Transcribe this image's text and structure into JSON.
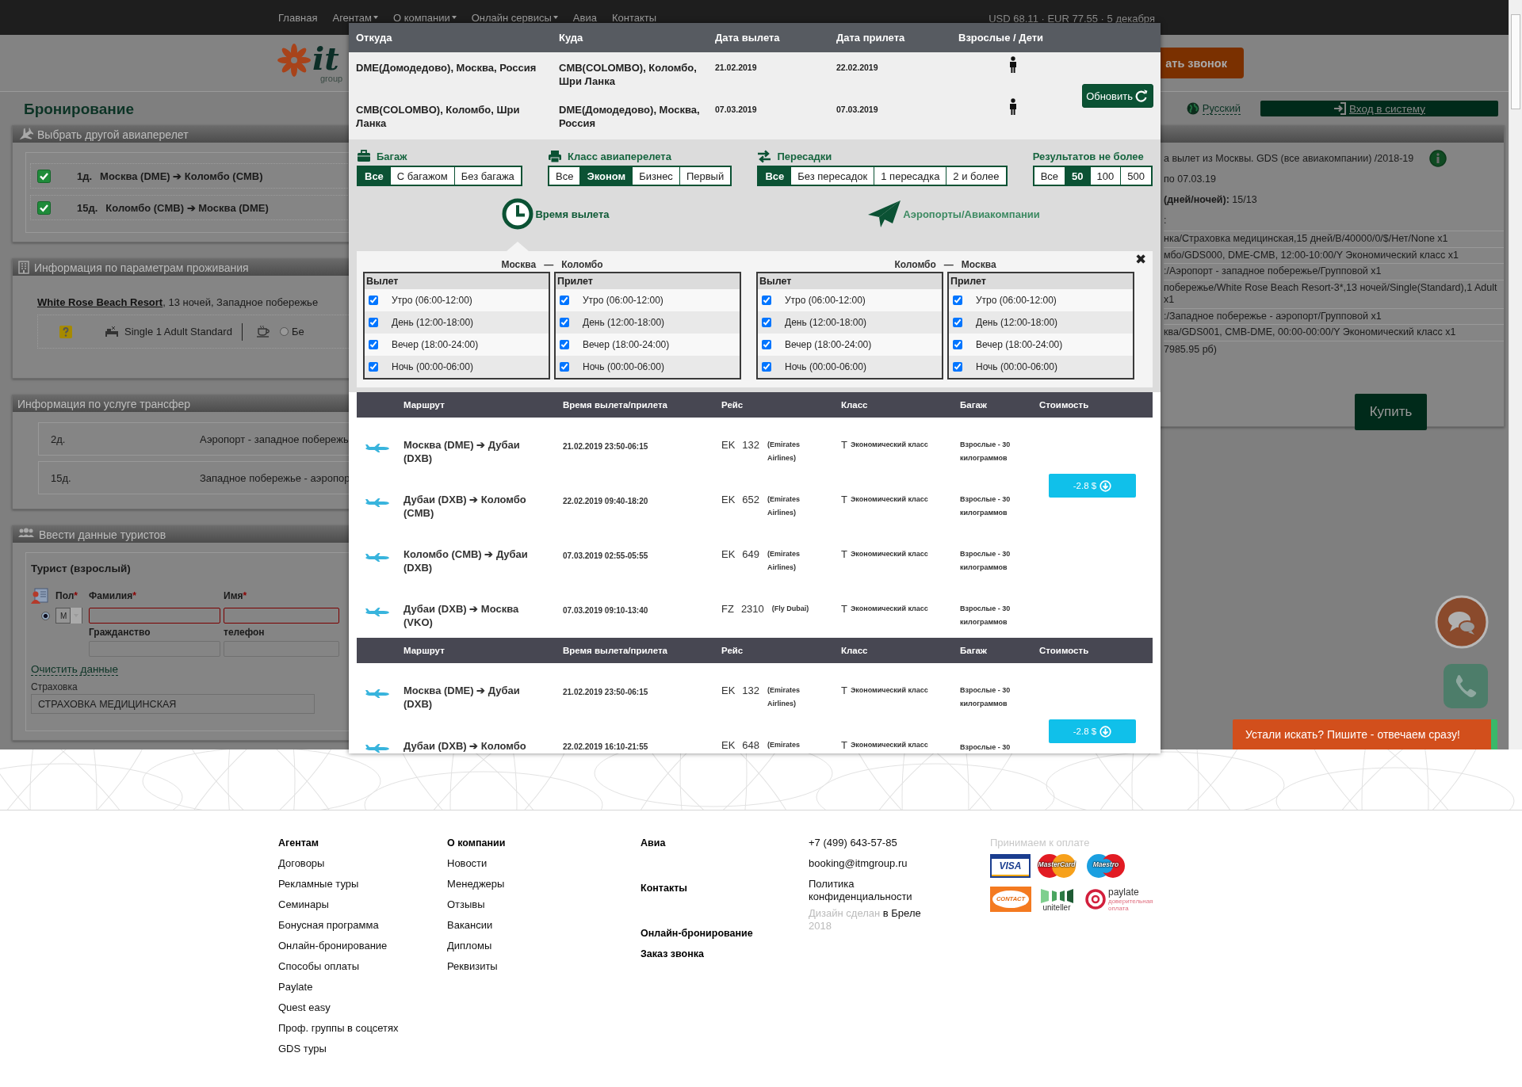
{
  "top_nav": {
    "links": [
      {
        "label": "Главная",
        "dropdown": false
      },
      {
        "label": "Агентам",
        "dropdown": true
      },
      {
        "label": "О компании",
        "dropdown": true
      },
      {
        "label": "Онлайн сервисы",
        "dropdown": true
      },
      {
        "label": "Авиа",
        "dropdown": false
      },
      {
        "label": "Контакты",
        "dropdown": false
      }
    ],
    "rates": "USD 68.11 · EUR 77.55 · 5 декабря"
  },
  "header": {
    "logo_text": "it",
    "logo_subtext": "group",
    "callback_button": "ать звонок",
    "language": "Русский",
    "login_button": "Вход в систему"
  },
  "page_title": "Бронирование",
  "flight_choice": {
    "title": "Выбрать другой авиаперелет",
    "items": [
      {
        "checked": true,
        "day": "1д.",
        "route": "Москва (DME) ➔ Коломбо (CMB)"
      },
      {
        "checked": true,
        "day": "15д.",
        "route": "Коломбо (CMB) ➔ Москва (DME)"
      }
    ]
  },
  "accommodation": {
    "title": "Информация по параметрам проживания",
    "hotel": "White Rose Beach Resort",
    "details": ", 13 ночей, Западное побережье",
    "room": "Single 1 Adult Standard",
    "meal_option": {
      "label": "Бе",
      "selected": false
    }
  },
  "transfer": {
    "title": "Информация по услуге трансфер",
    "rows": [
      {
        "day": "2д.",
        "route": "Аэропорт - западное побережь"
      },
      {
        "day": "15д.",
        "route": "Западное побережье - аэропор"
      }
    ]
  },
  "tourists": {
    "title": "Ввести данные туристов",
    "tourist_title": "Турист (взрослый)",
    "radio_selected": true,
    "fields": [
      {
        "kind": "select",
        "label": "Пол",
        "mark": "*",
        "value": "M"
      },
      {
        "kind": "text",
        "label": "Фамилия",
        "mark": "*",
        "invalid": true
      },
      {
        "kind": "text",
        "label": "Имя",
        "mark": "*",
        "invalid": true
      }
    ],
    "fields_2": [
      {
        "label": "Гражданство"
      },
      {
        "label": "телефон"
      }
    ],
    "clear_link": "Очистить данные",
    "insurance_label": "Страховка",
    "insurance_value": "СТРАХОВКА МЕДИЦИНСКАЯ"
  },
  "summary": {
    "lines": [
      "а вылет из Москвы. GDS (все авиакомпании) /2018-19",
      "по 07.03.19",
      "**(дней/ночей):** 15/13",
      ":"
    ],
    "services": [
      "нка/Страховка медицинская,15 дней/B/40000/0/$/Нет/None x1",
      "мбо/GDS000, DME-CMB, 12:00-10:00/Y Экономический класс x1",
      ":/Аэропорт - западное побережье/Групповой x1",
      "побережье/White Rose Beach Resort-3*,13 ночей/Single(Standard),1 Adult x1",
      ":/Западное побережье - аэропорт/Групповой x1",
      "ква/GDS001, CMB-DME, 00:00-00:00/Y Экономический класс x1"
    ],
    "total": "7985.95 рб)",
    "buy_button": "Купить"
  },
  "search": {
    "columns": [
      "Откуда",
      "Куда",
      "Дата вылета",
      "Дата прилета",
      "Взрослые / Дети"
    ],
    "rows": [
      {
        "from": "DME(Домодедово), Москва, Россия",
        "to": "CMB(COLOMBO), Коломбо, Шри Ланка",
        "departure": "21.02.2019",
        "arrival": "22.02.2019"
      },
      {
        "from": "CMB(COLOMBO), Коломбо, Шри Ланка",
        "to": "DME(Домодедово), Москва, Россия",
        "departure": "07.03.2019",
        "arrival": "07.03.2019"
      }
    ],
    "refresh_button": "Обновить"
  },
  "filters": [
    {
      "kind": "baggage",
      "label": "Багаж",
      "options": [
        {
          "label": "Все",
          "selected": true
        },
        {
          "label": "С багажом",
          "selected": false
        },
        {
          "label": "Без багажа",
          "selected": false
        }
      ]
    },
    {
      "kind": "class",
      "label": "Класс авиаперелета",
      "options": [
        {
          "label": "Все",
          "selected": false
        },
        {
          "label": "Эконом",
          "selected": true
        },
        {
          "label": "Бизнес",
          "selected": false
        },
        {
          "label": "Первый",
          "selected": false
        }
      ]
    },
    {
      "kind": "transfers",
      "label": "Пересадки",
      "options": [
        {
          "label": "Все",
          "selected": true
        },
        {
          "label": "Без пересадок",
          "selected": false
        },
        {
          "label": "1 пересадка",
          "selected": false
        },
        {
          "label": "2 и более",
          "selected": false
        }
      ]
    },
    {
      "kind": "limit",
      "label": "Результатов не более",
      "options": [
        {
          "label": "Все",
          "selected": false
        },
        {
          "label": "50",
          "selected": true
        },
        {
          "label": "100",
          "selected": false
        },
        {
          "label": "500",
          "selected": false
        }
      ]
    }
  ],
  "view_tabs": [
    {
      "kind": "clock",
      "label": "Время вылета",
      "selected": true
    },
    {
      "kind": "plane",
      "label": "Аэропорты/Авиакомпании",
      "selected": false
    }
  ],
  "time_filter": {
    "close": "✖",
    "directions": [
      {
        "from": "Москва",
        "separator": "—",
        "to": "Коломбо",
        "boxes": [
          {
            "title": "Вылет",
            "slots": [
              {
                "label": "Утро (06:00-12:00)",
                "checked": true
              },
              {
                "label": "День (12:00-18:00)",
                "checked": true
              },
              {
                "label": "Вечер (18:00-24:00)",
                "checked": true
              },
              {
                "label": "Ночь (00:00-06:00)",
                "checked": true
              }
            ]
          },
          {
            "title": "Прилет",
            "slots": [
              {
                "label": "Утро (06:00-12:00)",
                "checked": true
              },
              {
                "label": "День (12:00-18:00)",
                "checked": true
              },
              {
                "label": "Вечер (18:00-24:00)",
                "checked": true
              },
              {
                "label": "Ночь (00:00-06:00)",
                "checked": true
              }
            ]
          }
        ]
      },
      {
        "from": "Коломбо",
        "separator": "—",
        "to": "Москва",
        "boxes": [
          {
            "title": "Вылет",
            "slots": [
              {
                "label": "Утро (06:00-12:00)",
                "checked": true
              },
              {
                "label": "День (12:00-18:00)",
                "checked": true
              },
              {
                "label": "Вечер (18:00-24:00)",
                "checked": true
              },
              {
                "label": "Ночь (00:00-06:00)",
                "checked": true
              }
            ]
          },
          {
            "title": "Прилет",
            "slots": [
              {
                "label": "Утро (06:00-12:00)",
                "checked": true
              },
              {
                "label": "День (12:00-18:00)",
                "checked": true
              },
              {
                "label": "Вечер (18:00-24:00)",
                "checked": true
              },
              {
                "label": "Ночь (00:00-06:00)",
                "checked": true
              }
            ]
          }
        ]
      }
    ]
  },
  "results": {
    "groups": [
      {
        "columns": [
          "Маршрут",
          "Время вылета/прилета",
          "Рейс",
          "Класс",
          "Багаж",
          "Стоимость"
        ],
        "price": "-2.8 $",
        "flights": [
          {
            "route": "Москва (DME) ➔ Дубаи (DXB)",
            "times": "21.02.2019 23:50-06:15",
            "carrier": "EK",
            "number": "132",
            "airline": "(Emirates Airlines)",
            "fare": "T",
            "class": "Экономический класс",
            "baggage": "Взрослые - 30 килограммов"
          },
          {
            "route": "Дубаи (DXB) ➔ Коломбо (CMB)",
            "times": "22.02.2019 09:40-18:20",
            "carrier": "EK",
            "number": "652",
            "airline": "(Emirates Airlines)",
            "fare": "T",
            "class": "Экономический класс",
            "baggage": "Взрослые - 30 килограммов"
          },
          {
            "route": "Коломбо (CMB) ➔ Дубаи (DXB)",
            "times": "07.03.2019 02:55-05:55",
            "carrier": "EK",
            "number": "649",
            "airline": "(Emirates Airlines)",
            "fare": "T",
            "class": "Экономический класс",
            "baggage": "Взрослые - 30 килограммов"
          },
          {
            "route": "Дубаи (DXB) ➔ Москва (VKO)",
            "times": "07.03.2019 09:10-13:40",
            "carrier": "FZ",
            "number": "2310",
            "airline": "(Fly Dubai)",
            "fare": "T",
            "class": "Экономический класс",
            "baggage": "Взрослые - 30 килограммов"
          }
        ]
      },
      {
        "columns": [
          "Маршрут",
          "Время вылета/прилета",
          "Рейс",
          "Класс",
          "Багаж",
          "Стоимость"
        ],
        "price": "-2.8 $",
        "flights": [
          {
            "route": "Москва (DME) ➔ Дубаи (DXB)",
            "times": "21.02.2019 23:50-06:15",
            "carrier": "EK",
            "number": "132",
            "airline": "(Emirates Airlines)",
            "fare": "T",
            "class": "Экономический класс",
            "baggage": "Взрослые - 30 килограммов"
          },
          {
            "route": "Дубаи (DXB) ➔ Коломбо",
            "times": "22.02.2019 16:10-21:55",
            "carrier": "EK",
            "number": "648",
            "airline": "(Emirates",
            "fare": "T",
            "class": "Экономический класс",
            "baggage": "Взрослые - 30"
          }
        ]
      }
    ]
  },
  "footer": {
    "columns": [
      {
        "kind": "links",
        "heading": "Агентам",
        "links": [
          "Договоры",
          "Рекламные туры",
          "Семинары",
          "Бонусная программа",
          "Онлайн-бронирование",
          "Способы оплаты",
          "Paylate",
          "Quest easy",
          "Проф. группы в соцсетях",
          "GDS туры"
        ]
      },
      {
        "kind": "links",
        "heading": "О компании",
        "links": [
          "Новости",
          "Менеджеры",
          "Отзывы",
          "Вакансии",
          "Дипломы",
          "Реквизиты"
        ]
      },
      {
        "kind": "headings",
        "items": [
          "Авиа",
          "Контакты",
          "Онлайн-бронирование",
          "Заказ звонка"
        ]
      },
      {
        "kind": "contacts",
        "phone": "+7 (499) 643-57-85",
        "email": "booking@itmgroup.ru",
        "policy": "Политика конфиденциальности",
        "credit_prefix": "Дизайн сделан",
        "credit_link": "в Бреле",
        "year": "2018"
      },
      {
        "kind": "payments",
        "heading": "Принимаем к оплате",
        "methods": [
          {
            "kind": "visa",
            "label": "VISA"
          },
          {
            "kind": "mastercard",
            "label": "MasterCard"
          },
          {
            "kind": "maestro",
            "label": "Maestro"
          },
          {
            "kind": "contact",
            "label": "CONTACT"
          },
          {
            "kind": "uniteller",
            "label": "uniteller"
          },
          {
            "kind": "paylate",
            "label": "paylate",
            "tagline": "доверительная оплата"
          }
        ]
      }
    ]
  },
  "chat": {
    "banner": "Устали искать? Пишите - отвечаем сразу!"
  }
}
